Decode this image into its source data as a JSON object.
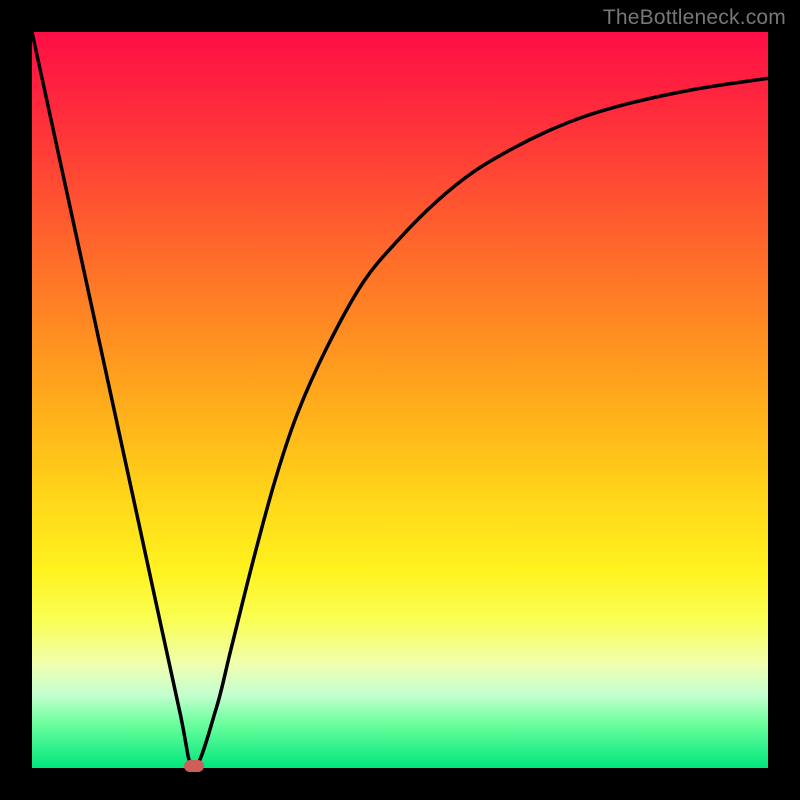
{
  "watermark": "TheBottleneck.com",
  "colors": {
    "frame": "#000000",
    "marker": "#cd5e5a",
    "curve": "#000000",
    "gradient_stops": [
      "#ff0d46",
      "#ff2f3b",
      "#ff5d2e",
      "#ff8a22",
      "#ffb41a",
      "#ffd81a",
      "#fff21e",
      "#faff55",
      "#efffb0",
      "#c4ffd0",
      "#6bff9d",
      "#00e77e"
    ]
  },
  "chart_data": {
    "type": "line",
    "title": "",
    "xlabel": "",
    "ylabel": "",
    "xlim": [
      0,
      100
    ],
    "ylim": [
      0,
      100
    ],
    "series": [
      {
        "name": "bottleneck-curve",
        "x": [
          0,
          5,
          10,
          15,
          20,
          22,
          25,
          27,
          30,
          33,
          36,
          40,
          45,
          50,
          55,
          60,
          65,
          70,
          75,
          80,
          85,
          90,
          95,
          100
        ],
        "values": [
          100,
          77,
          54,
          31,
          8,
          0,
          8,
          16,
          28,
          39,
          48,
          57,
          66,
          72,
          77,
          81,
          84,
          86.5,
          88.5,
          90,
          91.2,
          92.2,
          93,
          93.7
        ]
      }
    ],
    "annotations": [
      {
        "name": "min-marker",
        "x": 22,
        "y": 0
      }
    ]
  }
}
